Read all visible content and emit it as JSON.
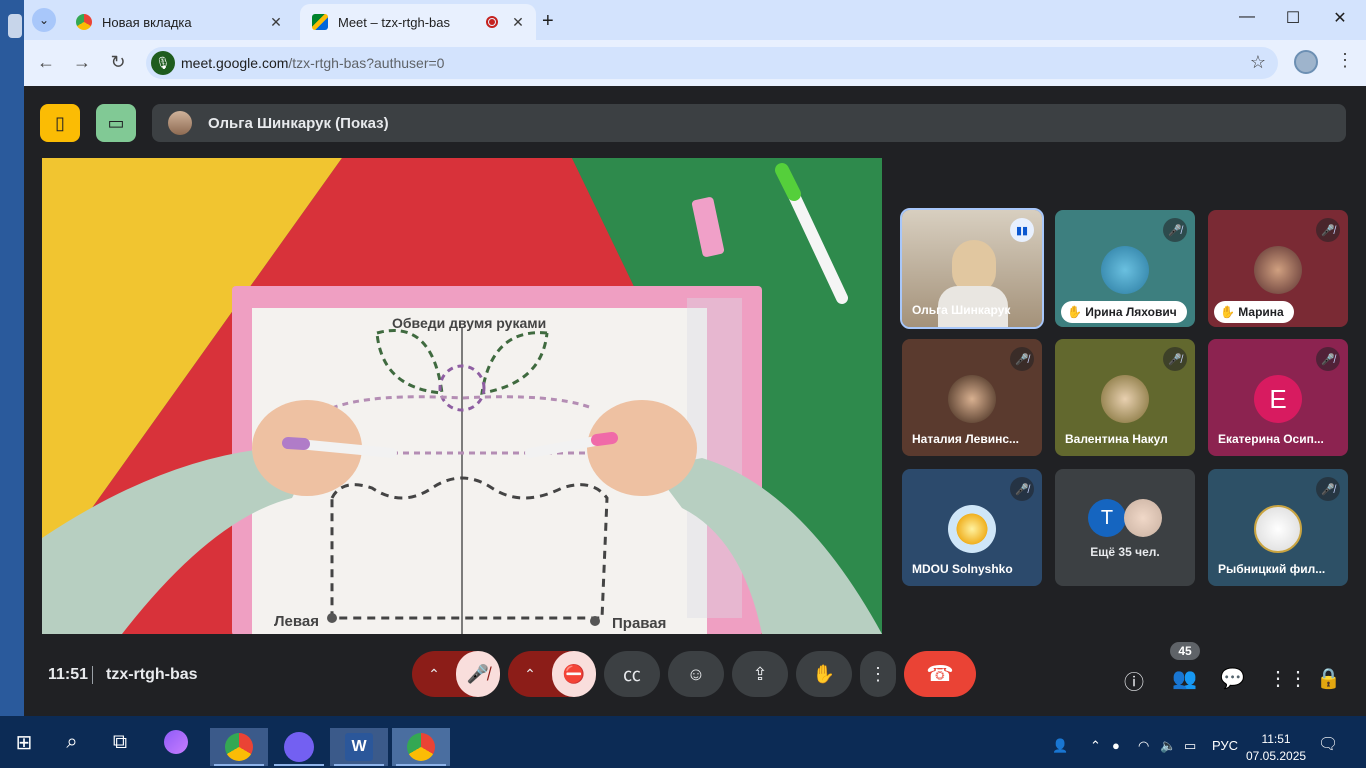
{
  "tabs": [
    {
      "title": "Новая вкладка",
      "favicon": "chrome-icon"
    },
    {
      "title": "Meet – tzx-rtgh-bas",
      "favicon": "meet-icon",
      "recording": true
    }
  ],
  "address_bar": {
    "host": "meet.google.com",
    "path": "/tzx-rtgh-bas?authuser=0"
  },
  "presenter": {
    "name": "Ольга Шинкарук (Показ)"
  },
  "worksheet": {
    "title": "Обведи двумя руками",
    "left_label": "Левая",
    "right_label": "Правая"
  },
  "participants": [
    {
      "name": "Ольга Шинкарук",
      "state": "speaking"
    },
    {
      "name": "Ирина Ляхович",
      "state": "muted",
      "hand": true
    },
    {
      "name": "Марина",
      "state": "muted",
      "hand": true
    },
    {
      "name": "Наталия Левинс...",
      "state": "muted"
    },
    {
      "name": "Валентина Накул",
      "state": "muted"
    },
    {
      "name": "Екатерина Осип...",
      "state": "muted",
      "initial": "E",
      "color": "#c2185b"
    },
    {
      "name": "MDOU Solnyshko",
      "state": "muted"
    },
    {
      "name": "Ещё 35 чел.",
      "initial": "T",
      "color": "#1565c0"
    },
    {
      "name": "Рыбницкий фил...",
      "state": "muted"
    }
  ],
  "meeting": {
    "time": "11:51",
    "code": "tzx-rtgh-bas",
    "people_count": "45"
  },
  "taskbar": {
    "lang": "РУС",
    "time": "11:51",
    "date": "07.05.2025"
  }
}
